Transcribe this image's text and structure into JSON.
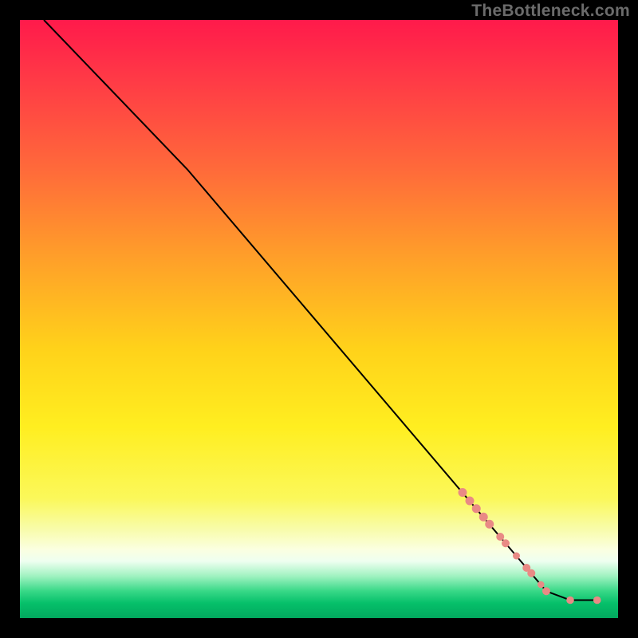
{
  "watermark": "TheBottleneck.com",
  "colors": {
    "background": "#000000",
    "marker": "#e98a85",
    "line": "#000000",
    "gradient_stops": [
      {
        "offset": 0.0,
        "color": "#ff1a4b"
      },
      {
        "offset": 0.1,
        "color": "#ff3a46"
      },
      {
        "offset": 0.25,
        "color": "#ff6a3a"
      },
      {
        "offset": 0.4,
        "color": "#ffa029"
      },
      {
        "offset": 0.55,
        "color": "#ffd21a"
      },
      {
        "offset": 0.68,
        "color": "#ffee20"
      },
      {
        "offset": 0.8,
        "color": "#fbf85a"
      },
      {
        "offset": 0.85,
        "color": "#f8fca8"
      },
      {
        "offset": 0.885,
        "color": "#fbffe0"
      },
      {
        "offset": 0.905,
        "color": "#eefff0"
      },
      {
        "offset": 0.93,
        "color": "#9ff2c0"
      },
      {
        "offset": 0.955,
        "color": "#38d887"
      },
      {
        "offset": 0.975,
        "color": "#06c06a"
      },
      {
        "offset": 1.0,
        "color": "#02a85e"
      }
    ]
  },
  "chart_data": {
    "type": "line",
    "title": "",
    "xlabel": "",
    "ylabel": "",
    "xlim": [
      0,
      100
    ],
    "ylim": [
      0,
      100
    ],
    "line_points": [
      {
        "x": 4,
        "y": 100
      },
      {
        "x": 28,
        "y": 75
      },
      {
        "x": 88,
        "y": 4.5
      },
      {
        "x": 92,
        "y": 3
      },
      {
        "x": 96.5,
        "y": 3
      }
    ],
    "series": [
      {
        "name": "markers",
        "points": [
          {
            "x": 74.0,
            "y": 21.0,
            "r": 5.5
          },
          {
            "x": 75.2,
            "y": 19.6,
            "r": 5.5
          },
          {
            "x": 76.3,
            "y": 18.3,
            "r": 5.5
          },
          {
            "x": 77.5,
            "y": 16.9,
            "r": 5.5
          },
          {
            "x": 78.5,
            "y": 15.7,
            "r": 5.5
          },
          {
            "x": 80.3,
            "y": 13.6,
            "r": 5.0
          },
          {
            "x": 81.2,
            "y": 12.5,
            "r": 5.0
          },
          {
            "x": 83.0,
            "y": 10.4,
            "r": 4.5
          },
          {
            "x": 84.7,
            "y": 8.4,
            "r": 5.0
          },
          {
            "x": 85.5,
            "y": 7.5,
            "r": 5.0
          },
          {
            "x": 87.1,
            "y": 5.6,
            "r": 4.3
          },
          {
            "x": 88.0,
            "y": 4.5,
            "r": 5.0
          },
          {
            "x": 92.0,
            "y": 3.0,
            "r": 4.8
          },
          {
            "x": 96.5,
            "y": 3.0,
            "r": 4.8
          }
        ]
      }
    ]
  }
}
